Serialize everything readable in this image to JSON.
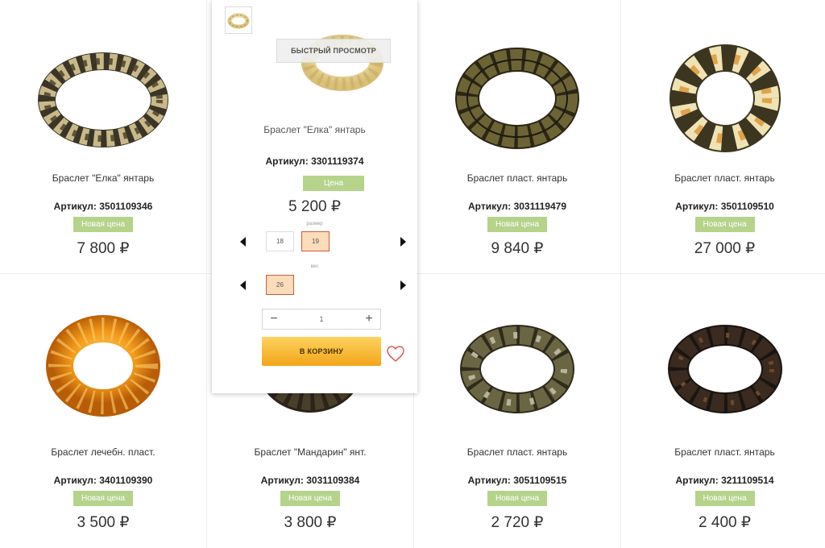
{
  "products": [
    {
      "name": "Браслет \"Елка\" янтарь",
      "sku_label": "Артикул:",
      "sku": "3501109346",
      "badge": "Новая цена",
      "price": "7 800 ₽",
      "icon": "bracelet-image"
    },
    {
      "name": "",
      "sku_label": "",
      "sku": "",
      "badge": "",
      "price": "",
      "icon": "bracelet-image"
    },
    {
      "name": "Браслет пласт. янтарь",
      "sku_label": "Артикул:",
      "sku": "3031119479",
      "badge": "Новая цена",
      "price": "9 840 ₽",
      "icon": "bracelet-image"
    },
    {
      "name": "Браслет пласт. янтарь",
      "sku_label": "Артикул:",
      "sku": "3501109510",
      "badge": "Новая цена",
      "price": "27 000 ₽",
      "icon": "bracelet-image"
    },
    {
      "name": "Браслет лечебн. пласт.",
      "sku_label": "Артикул:",
      "sku": "3401109390",
      "badge": "Новая цена",
      "price": "3 500 ₽",
      "icon": "bracelet-image"
    },
    {
      "name": "Браслет \"Мандарин\" янт.",
      "sku_label": "Артикул:",
      "sku": "3031109384",
      "badge": "Новая цена",
      "price": "3 800 ₽",
      "icon": "bracelet-image"
    },
    {
      "name": "Браслет пласт. янтарь",
      "sku_label": "Артикул:",
      "sku": "3051109515",
      "badge": "Новая цена",
      "price": "2 720 ₽",
      "icon": "bracelet-image"
    },
    {
      "name": "Браслет пласт. янтарь",
      "sku_label": "Артикул:",
      "sku": "3211109514",
      "badge": "Новая цена",
      "price": "2 400 ₽",
      "icon": "bracelet-image"
    }
  ],
  "quick_view": {
    "quick_view_label": "БЫСТРЫЙ ПРОСМОТР",
    "name": "Браслет \"Елка\" янтарь",
    "sku_label": "Артикул:",
    "sku": "3301119374",
    "badge": "Цена",
    "price": "5 200 ₽",
    "size_label": "размер",
    "sizes": [
      "18",
      "19"
    ],
    "selected_size": "19",
    "weight_label": "вес",
    "weights": [
      "26"
    ],
    "selected_weight": "26",
    "quantity": "1",
    "minus": "−",
    "plus": "+",
    "add_to_cart": "В КОРЗИНУ"
  },
  "colors": {
    "badge": "#b5d38b",
    "cart_top": "#fdd25d",
    "cart_bottom": "#f2a51a",
    "selected_option": "#fbdcbb",
    "selected_border": "#d15a3a",
    "heart": "#d9534f"
  }
}
